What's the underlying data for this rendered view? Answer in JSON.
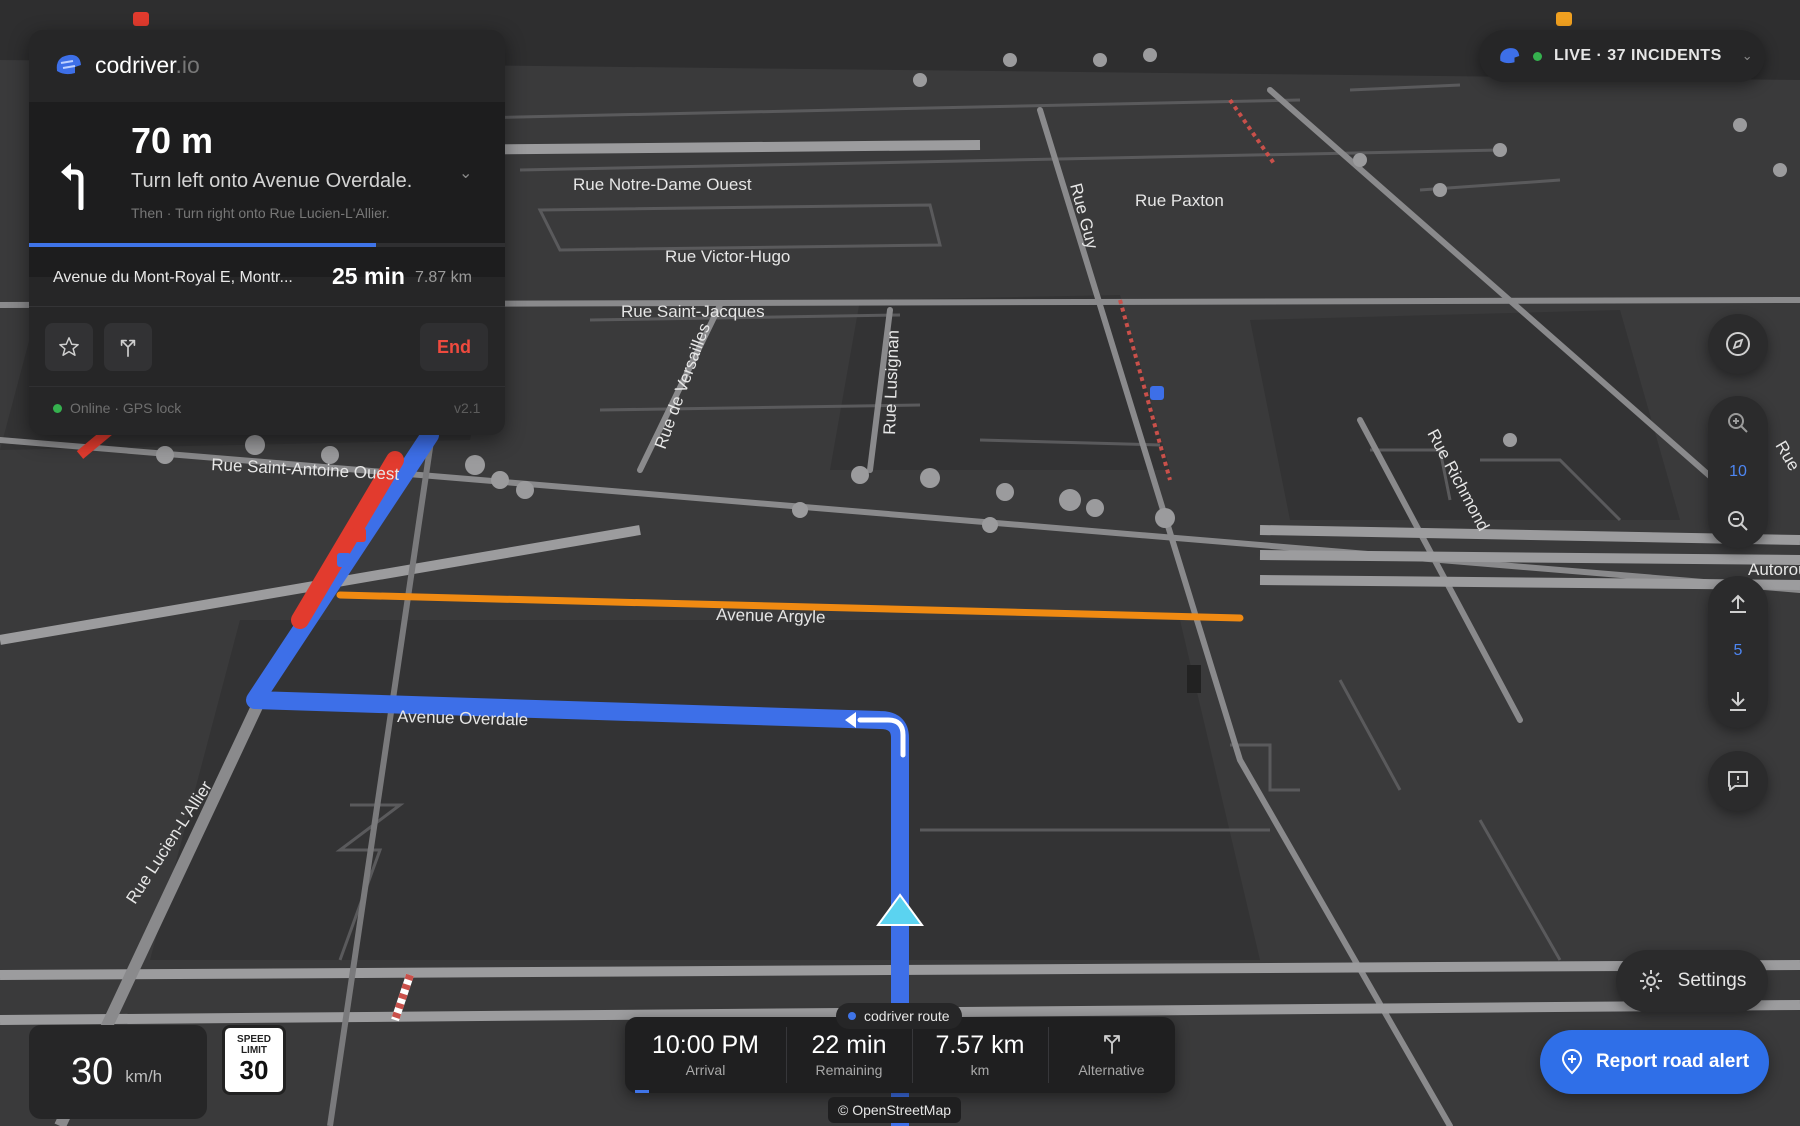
{
  "brand": {
    "name": "codriver",
    "tld": ".io"
  },
  "maneuver": {
    "distance": "70 m",
    "instruction": "Turn left onto Avenue Overdale.",
    "then": "Then · Turn right onto Rue Lucien-L'Allier.",
    "progress": 0.73
  },
  "trip": {
    "destination": "Avenue du Mont-Royal E, Montr...",
    "eta": "25 min",
    "distance": "7.87 km"
  },
  "actions": {
    "favorite_icon": "star-icon",
    "alternatives_icon": "fork-route-icon",
    "end_label": "End"
  },
  "status": {
    "text": "Online · GPS lock",
    "version": "v2.1"
  },
  "live": {
    "text": "LIVE · 37 INCIDENTS"
  },
  "controls": {
    "zoom_level": "10",
    "tilt_level": "5",
    "settings_label": "Settings",
    "report_label": "Report road alert"
  },
  "speed": {
    "value": "30",
    "unit": "km/h",
    "limit_label_1": "SPEED",
    "limit_label_2": "LIMIT",
    "limit_value": "30"
  },
  "route_bar": {
    "tag": "codriver route",
    "arrival_value": "10:00 PM",
    "arrival_label": "Arrival",
    "remaining_value": "22 min",
    "remaining_label": "Remaining",
    "distance_value": "7.57 km",
    "distance_label": "km",
    "alternative_label": "Alternative"
  },
  "attribution": "© OpenStreetMap",
  "streets": {
    "notre_dame": "Rue Notre-Dame Ouest",
    "victor_hugo": "Rue Victor-Hugo",
    "saint_jacques": "Rue Saint-Jacques",
    "paxton": "Rue Paxton",
    "guy": "Rue Guy",
    "versailles": "Rue de Versailles",
    "lusignan": "Rue Lusignan",
    "richmond": "Rue Richmond",
    "saint_antoine": "Rue Saint-Antoine Ouest",
    "argyle": "Avenue Argyle",
    "overdale": "Avenue Overdale",
    "lucien": "Rue Lucien-L'Allier",
    "autoroute": "Autorou",
    "ru": "Rue"
  },
  "colors": {
    "accent": "#3f74e8",
    "route": "#3d6fe8",
    "traffic_heavy": "#e23b2e",
    "traffic_slow": "#f08a12",
    "online": "#35b14e",
    "end": "#ef4a3e"
  }
}
